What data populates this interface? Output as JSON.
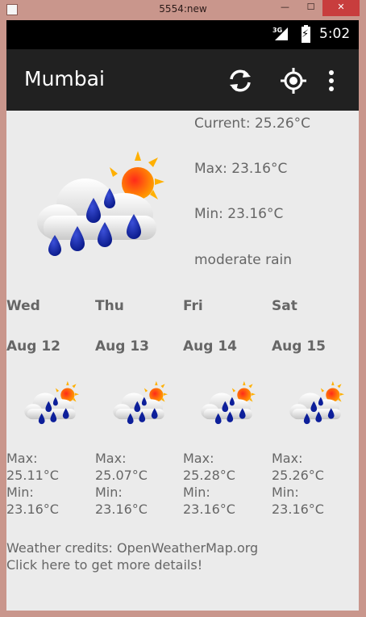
{
  "window": {
    "title": "5554:new",
    "min_glyph": "—",
    "max_glyph": "☐",
    "close_glyph": "✕"
  },
  "statusbar": {
    "network": "3G",
    "time": "5:02"
  },
  "appbar": {
    "title": "Mumbai",
    "icons": [
      "refresh-icon",
      "locate-icon",
      "more-vert-icon"
    ]
  },
  "current": {
    "current_text": "Current: 25.26°C",
    "max_text": "Max: 23.16°C",
    "min_text": "Min: 23.16°C",
    "description": "moderate rain",
    "icon": "rain-cloud-sun-icon"
  },
  "forecast": [
    {
      "day": "Wed",
      "date": "Aug 12",
      "max_label": "Max:",
      "max_value": "25.11°C",
      "min_label": "Min:",
      "min_value": "23.16°C"
    },
    {
      "day": "Thu",
      "date": "Aug 13",
      "max_label": "Max:",
      "max_value": "25.07°C",
      "min_label": "Min:",
      "min_value": "23.16°C"
    },
    {
      "day": "Fri",
      "date": "Aug 14",
      "max_label": "Max:",
      "max_value": "25.28°C",
      "min_label": "Min:",
      "min_value": "23.16°C"
    },
    {
      "day": "Sat",
      "date": "Aug 15",
      "max_label": "Max:",
      "max_value": "25.26°C",
      "min_label": "Min:",
      "min_value": "23.16°C"
    }
  ],
  "footer": {
    "credits": "Weather credits: OpenWeatherMap.org",
    "details_link": "Click here to get more details!"
  },
  "colors": {
    "appbar": "#212121",
    "background": "#ebebeb",
    "text": "#666666",
    "frame": "#c9968c"
  }
}
